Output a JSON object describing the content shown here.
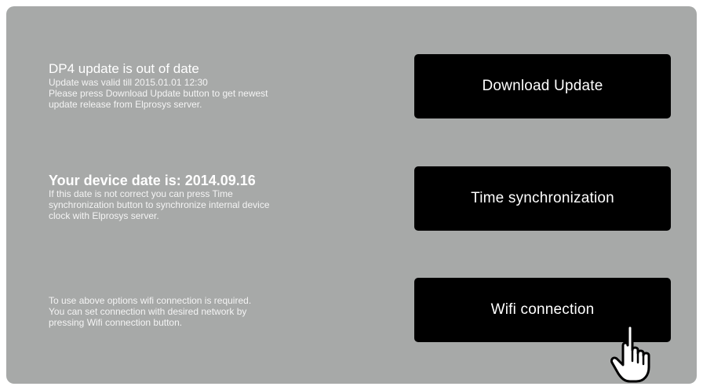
{
  "update_section": {
    "title": "DP4 update is out of date",
    "desc_line1": "Update was valid till 2015.01.01 12:30",
    "desc_line2": "Please press Download Update button to get newest",
    "desc_line3": "update release from Elprosys server.",
    "button_label": "Download Update"
  },
  "time_section": {
    "title": "Your device date is: 2014.09.16",
    "desc_line1": "If this date is not correct you can press Time",
    "desc_line2": "synchronization button to synchronize internal device",
    "desc_line3": "clock with Elprosys server.",
    "button_label": "Time synchronization"
  },
  "wifi_section": {
    "desc_line1": "To use above options wifi connection is required.",
    "desc_line2": "You can set connection with desired network by",
    "desc_line3": "pressing Wifi connection button.",
    "button_label": "Wifi connection"
  },
  "cursor": {
    "icon": "hand-pointer-icon"
  },
  "colors": {
    "panel_background": "#a7a9a8",
    "button_background": "#000000",
    "text": "#ffffff"
  }
}
